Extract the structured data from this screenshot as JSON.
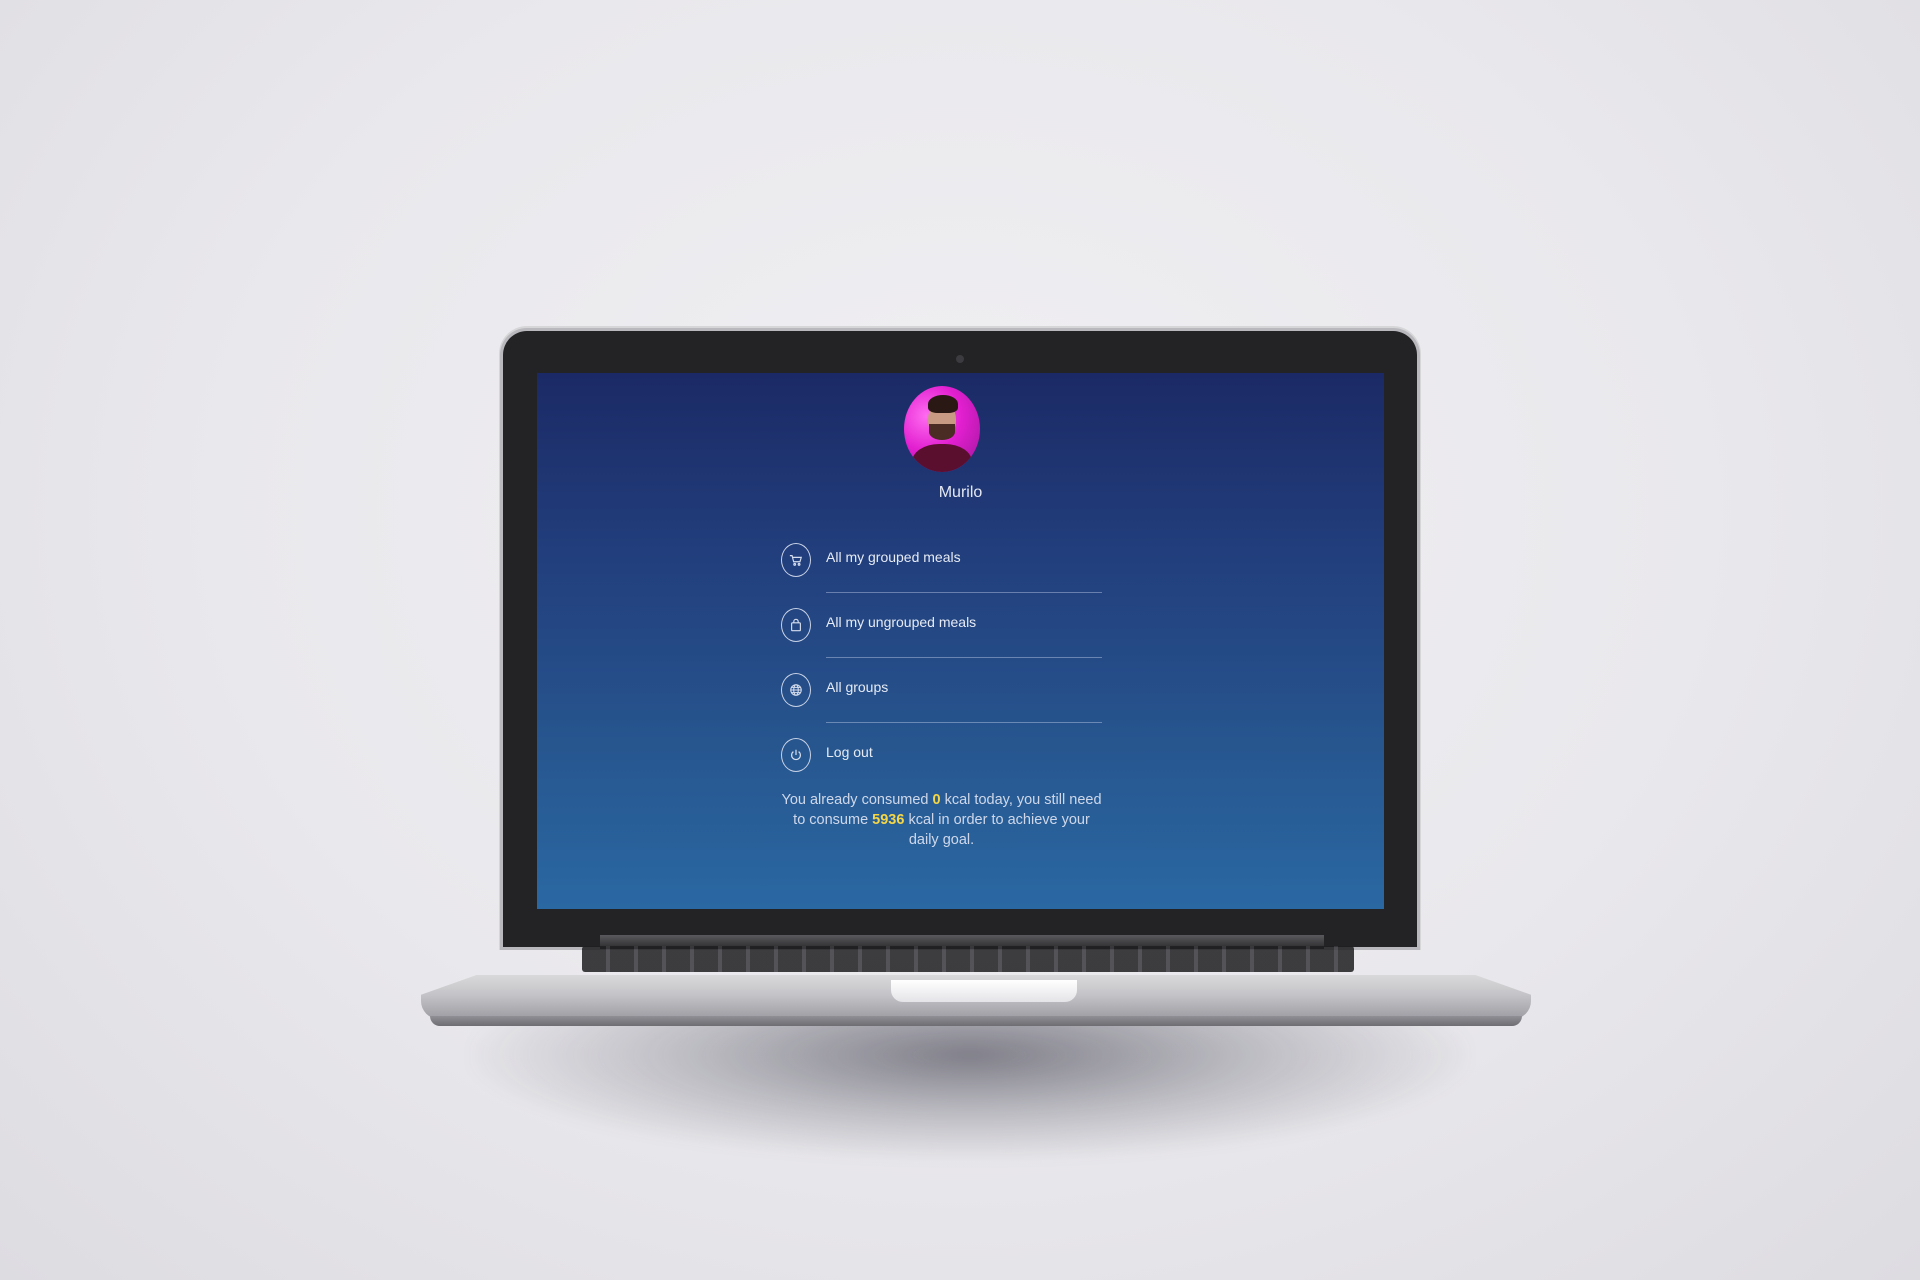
{
  "profile": {
    "name": "Murilo"
  },
  "menu": [
    {
      "label": "All my grouped meals",
      "icon": "shopping-cart-icon"
    },
    {
      "label": "All my ungrouped meals",
      "icon": "shopping-bag-icon"
    },
    {
      "label": "All groups",
      "icon": "globe-icon"
    },
    {
      "label": "Log out",
      "icon": "power-icon"
    }
  ],
  "summary": {
    "prefix": "You already consumed ",
    "consumed": "0",
    "middle": " kcal today, you still need to consume ",
    "remaining": "5936",
    "suffix": " kcal in order to achieve your daily goal."
  },
  "colors": {
    "highlight": "#f4d646",
    "screen_top": "#1b2a66",
    "screen_bottom": "#2a68a3"
  }
}
